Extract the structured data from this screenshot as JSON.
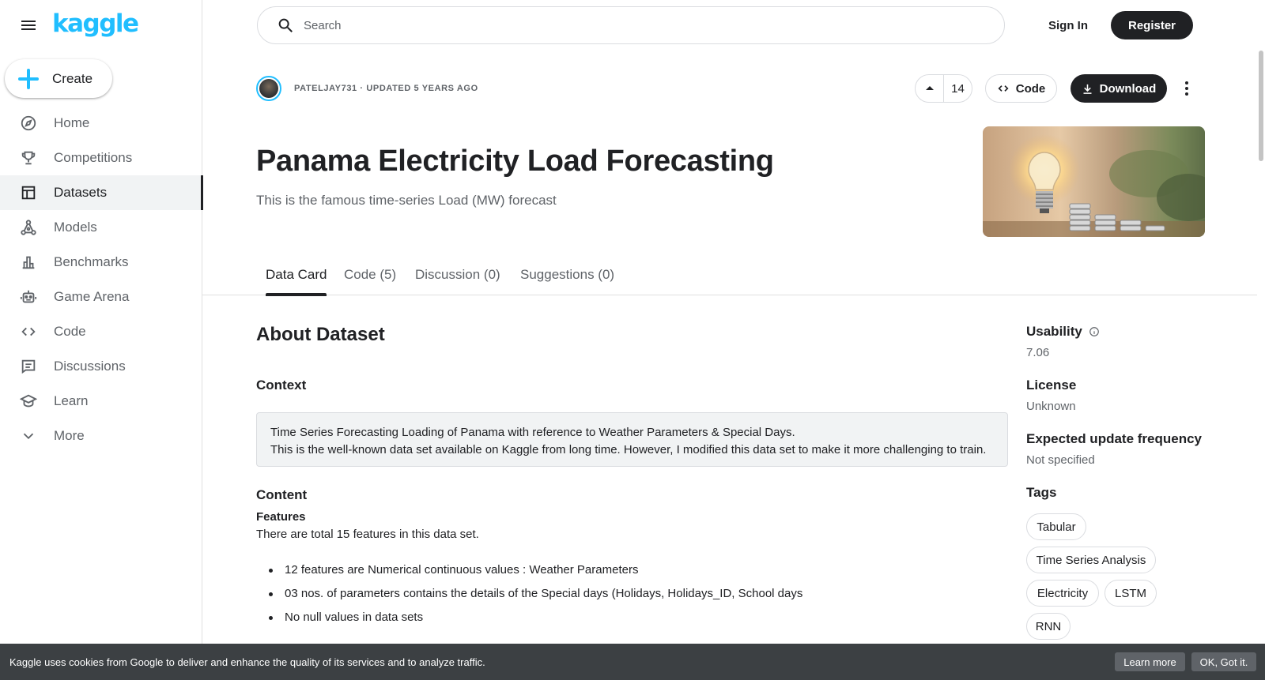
{
  "brand": {
    "logo_text": "kaggle",
    "color": "#20beff"
  },
  "sidebar": {
    "create_label": "Create",
    "items": [
      {
        "label": "Home",
        "icon": "compass-icon"
      },
      {
        "label": "Competitions",
        "icon": "trophy-icon"
      },
      {
        "label": "Datasets",
        "icon": "table-icon",
        "active": true
      },
      {
        "label": "Models",
        "icon": "models-icon"
      },
      {
        "label": "Benchmarks",
        "icon": "bar-chart-icon"
      },
      {
        "label": "Game Arena",
        "icon": "robot-icon"
      },
      {
        "label": "Code",
        "icon": "code-icon"
      },
      {
        "label": "Discussions",
        "icon": "comments-icon"
      },
      {
        "label": "Learn",
        "icon": "graduation-cap-icon"
      },
      {
        "label": "More",
        "icon": "chevron-down-icon"
      }
    ]
  },
  "header": {
    "search_placeholder": "Search",
    "signin_label": "Sign In",
    "register_label": "Register"
  },
  "dataset": {
    "meta": "PATELJAY731 · UPDATED 5 YEARS AGO",
    "votes": "14",
    "code_label": "Code",
    "download_label": "Download",
    "title": "Panama Electricity Load Forecasting",
    "subtitle": "This is the famous time-series Load (MW) forecast"
  },
  "tabs": [
    "Data Card",
    "Code (5)",
    "Discussion (0)",
    "Suggestions (0)"
  ],
  "content": {
    "about_heading": "About Dataset",
    "context_heading": "Context",
    "context_line1": "Time Series Forecasting Loading of Panama with reference to Weather Parameters & Special Days.",
    "context_line2": "This is the well-known data set available on Kaggle from long time. However, I modified this data set to make it more challenging to train.",
    "content_heading": "Content",
    "features_heading": "Features",
    "features_text": "There are total 15 features in this data set.",
    "bullets": [
      "12 features are Numerical continuous values : Weather Parameters",
      "03 nos. of parameters contains the details of the Special days (Holidays, Holidays_ID, School days",
      "No null values in data sets"
    ]
  },
  "side": {
    "usability_label": "Usability",
    "usability_value": "7.06",
    "license_label": "License",
    "license_value": "Unknown",
    "frequency_label": "Expected update frequency",
    "frequency_value": "Not specified",
    "tags_label": "Tags",
    "tags": [
      "Tabular",
      "Time Series Analysis",
      "Electricity",
      "LSTM",
      "RNN"
    ]
  },
  "cookie": {
    "text": "Kaggle uses cookies from Google to deliver and enhance the quality of its services and to analyze traffic.",
    "learn_more": "Learn more",
    "ok": "OK, Got it."
  }
}
